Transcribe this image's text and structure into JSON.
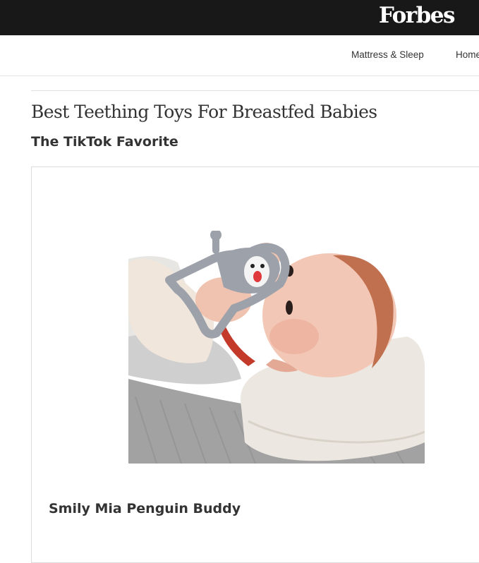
{
  "header": {
    "logo_text": "Forbes"
  },
  "nav": {
    "items": [
      "Mattress & Sleep",
      "Home"
    ]
  },
  "article": {
    "title": "Best Teething Toys For Breastfed Babies",
    "section_label": "The TikTok Favorite"
  },
  "product": {
    "name": "Smily Mia Penguin Buddy",
    "image_subject": "baby lying on white pillow chewing gray penguin teether mitten"
  },
  "colors": {
    "topbar": "#181818",
    "text": "#333333",
    "teether_gray": "#9da1aa",
    "penguin_beak": "#e0393b"
  }
}
